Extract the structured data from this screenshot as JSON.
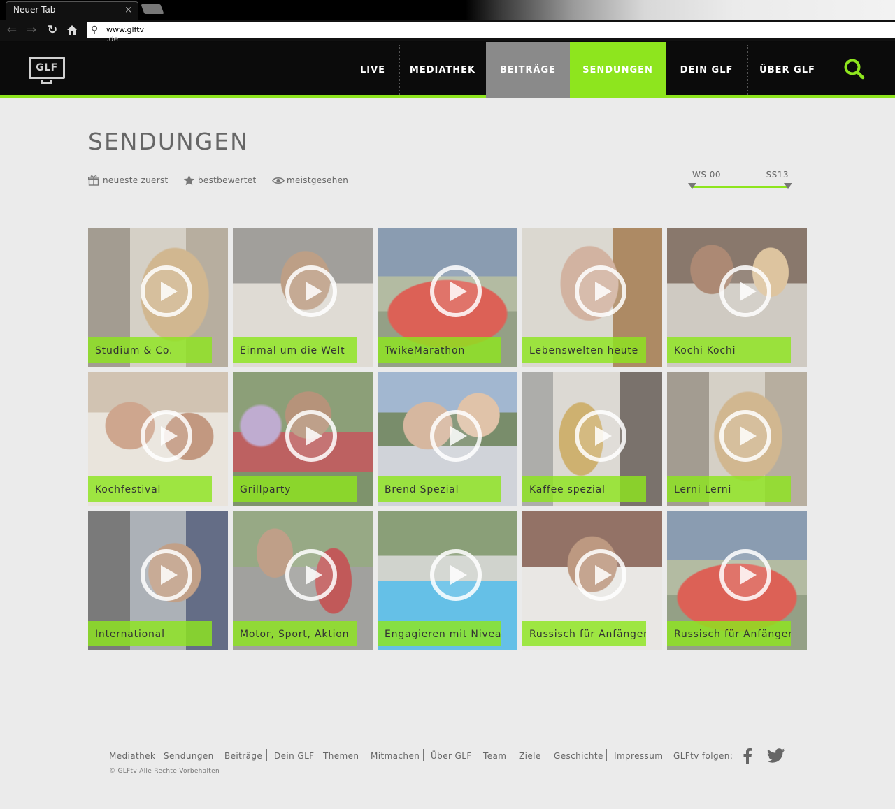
{
  "browser": {
    "tab_title": "Neuer Tab",
    "tab_close": "×",
    "url": "www.glftv",
    "url_overflow": ".de"
  },
  "header": {
    "logo": "GLF",
    "nav": [
      {
        "label": "LIVE"
      },
      {
        "label": "MEDIATHEK"
      },
      {
        "label": "BEITRÄGE"
      },
      {
        "label": "SENDUNGEN"
      },
      {
        "label": "DEIN GLF"
      },
      {
        "label": "ÜBER GLF"
      }
    ],
    "active_item": "SENDUNGEN",
    "accent_color": "#8ee51e",
    "hover_color": "#8a8a8a"
  },
  "page": {
    "title": "SENDUNGEN",
    "sort_options": [
      {
        "label": "neueste zuerst",
        "icon": "gift-icon"
      },
      {
        "label": "bestbewertet",
        "icon": "star-icon"
      },
      {
        "label": "meistgesehen",
        "icon": "eye-icon"
      }
    ],
    "semester_range": {
      "start": "WS 00",
      "end": "SS13"
    }
  },
  "shows": [
    {
      "title": "Studium & Co."
    },
    {
      "title": "Einmal um die Welt"
    },
    {
      "title": "TwikeMarathon"
    },
    {
      "title": "Lebenswelten heute"
    },
    {
      "title": "Kochi Kochi"
    },
    {
      "title": "Kochfestival"
    },
    {
      "title": "Grillparty"
    },
    {
      "title": "Brend Spezial"
    },
    {
      "title": "Kaffee spezial"
    },
    {
      "title": "Lerni Lerni"
    },
    {
      "title": "International"
    },
    {
      "title": "Motor, Sport, Aktion"
    },
    {
      "title": "Engagieren mit Niveau"
    },
    {
      "title": "Russisch für Anfänger"
    },
    {
      "title": "Russisch für Anfänger"
    }
  ],
  "footer": {
    "links": [
      {
        "label": "Mediathek"
      },
      {
        "label": "Sendungen"
      },
      {
        "label": "Beiträge"
      },
      {
        "label": "Dein GLF"
      },
      {
        "label": "Themen"
      },
      {
        "label": "Mitmachen"
      },
      {
        "label": "Über GLF"
      },
      {
        "label": "Team"
      },
      {
        "label": "Ziele"
      },
      {
        "label": "Geschichte"
      },
      {
        "label": "Impressum"
      }
    ],
    "follow_label": "GLFtv folgen:",
    "copyright": "© GLFtv Alle Rechte Vorbehalten"
  }
}
